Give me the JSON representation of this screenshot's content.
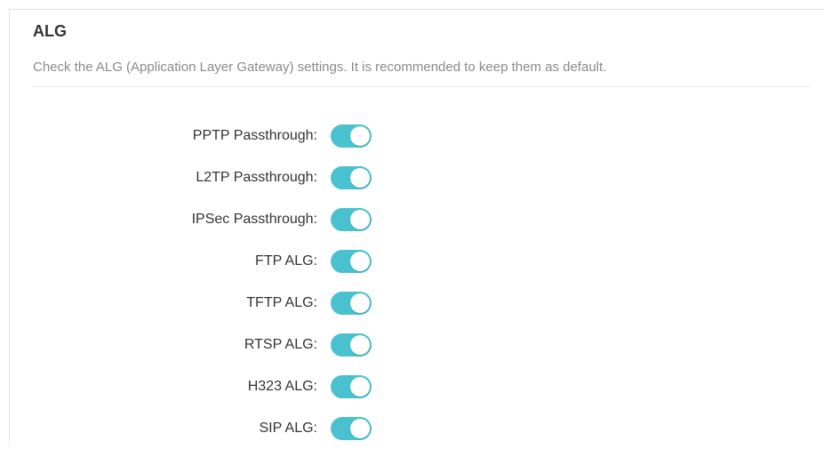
{
  "section": {
    "title": "ALG",
    "description": "Check the ALG (Application Layer Gateway) settings. It is recommended to keep them as default."
  },
  "toggle_color": "#4ac1cf",
  "settings": [
    {
      "label": "PPTP Passthrough:",
      "enabled": true
    },
    {
      "label": "L2TP Passthrough:",
      "enabled": true
    },
    {
      "label": "IPSec Passthrough:",
      "enabled": true
    },
    {
      "label": "FTP ALG:",
      "enabled": true
    },
    {
      "label": "TFTP ALG:",
      "enabled": true
    },
    {
      "label": "RTSP ALG:",
      "enabled": true
    },
    {
      "label": "H323 ALG:",
      "enabled": true
    },
    {
      "label": "SIP ALG:",
      "enabled": true
    }
  ]
}
